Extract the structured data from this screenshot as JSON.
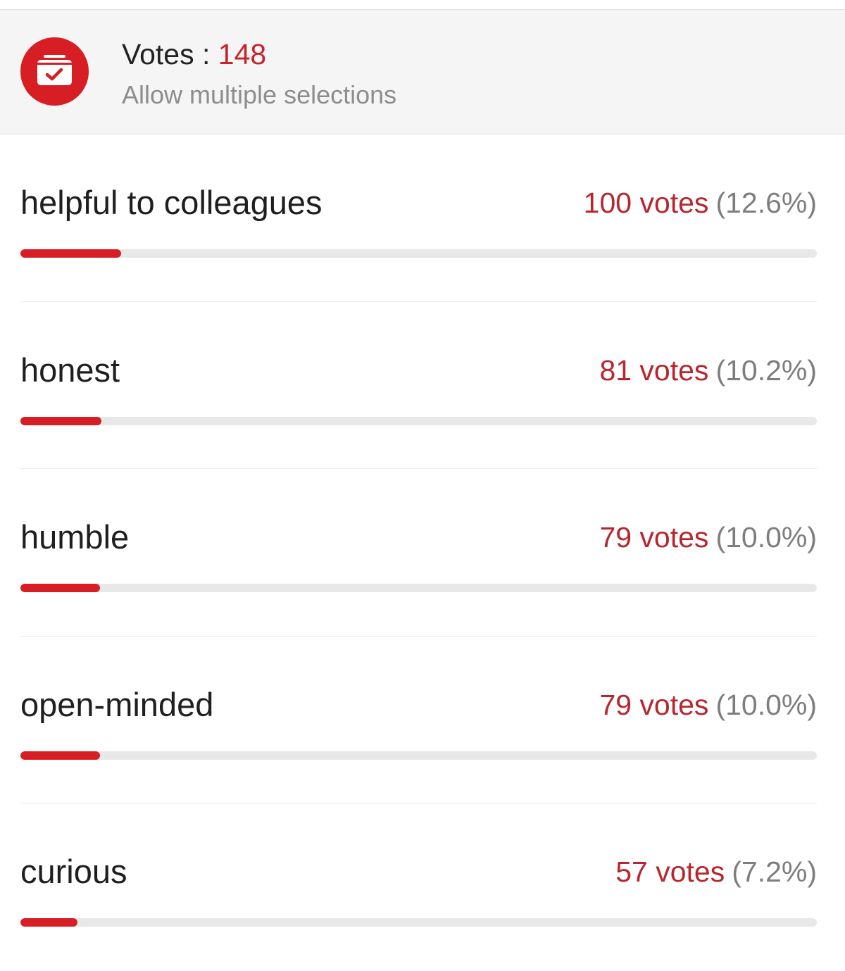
{
  "theme": {
    "accent": "#d81e25",
    "count_color": "#c8232c",
    "muted_text": "#8d8d8d",
    "track_color": "#e8e8e8"
  },
  "header": {
    "icon": "ballot-box-check-icon",
    "votes_label": "Votes : ",
    "votes_count": "148",
    "subtitle": "Allow multiple selections"
  },
  "options": [
    {
      "label": "helpful to colleagues",
      "votes_text": "100 votes",
      "pct_text": "(12.6%)",
      "fraction": 0.126
    },
    {
      "label": "honest",
      "votes_text": "81 votes",
      "pct_text": "(10.2%)",
      "fraction": 0.102
    },
    {
      "label": "humble",
      "votes_text": "79 votes",
      "pct_text": "(10.0%)",
      "fraction": 0.1
    },
    {
      "label": "open-minded",
      "votes_text": "79 votes",
      "pct_text": "(10.0%)",
      "fraction": 0.1
    },
    {
      "label": "curious",
      "votes_text": "57 votes",
      "pct_text": "(7.2%)",
      "fraction": 0.072
    }
  ]
}
